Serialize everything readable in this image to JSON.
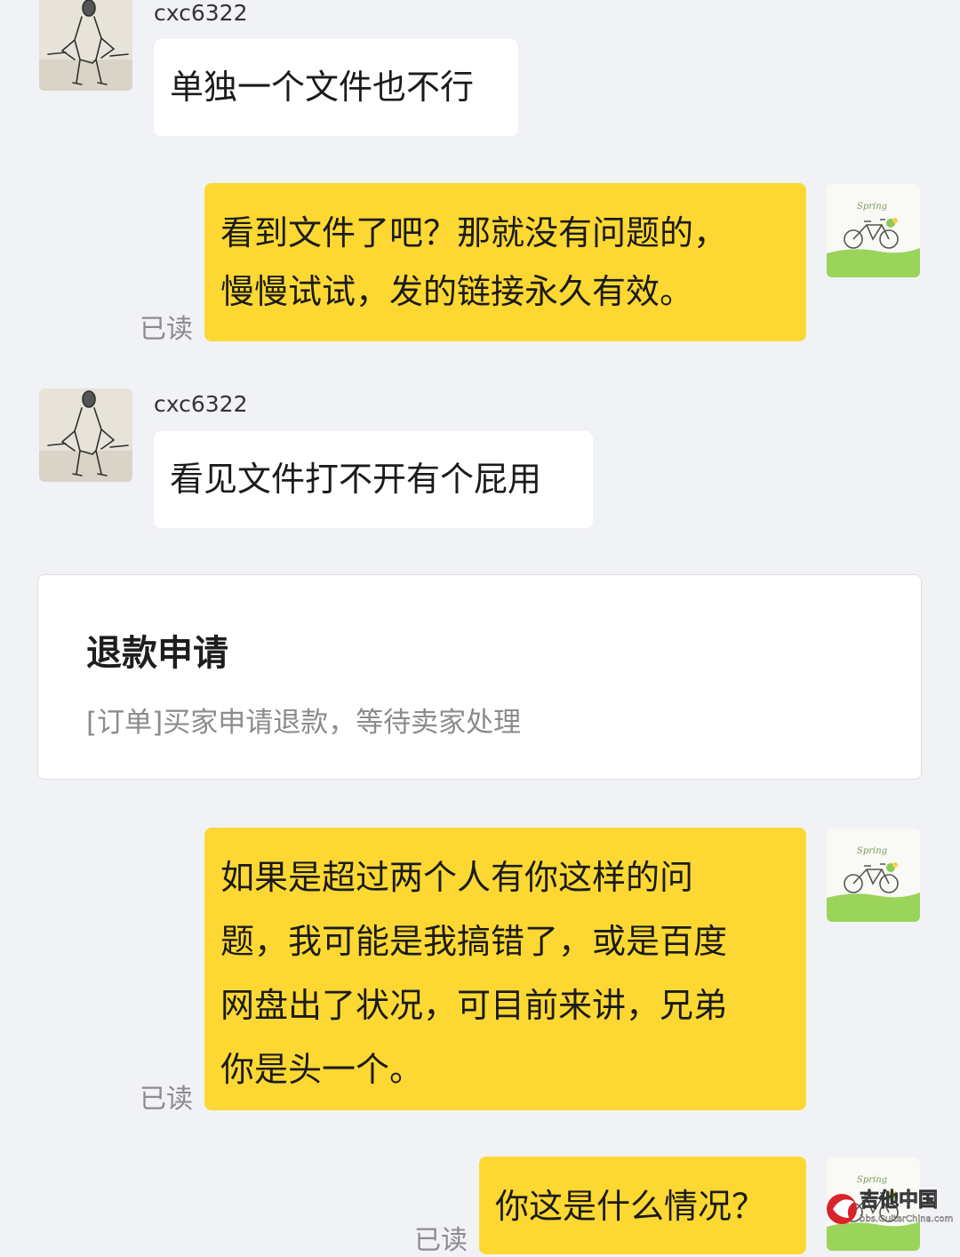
{
  "messages": [
    {
      "sender": "cxc6322",
      "text": "单独一个文件也不行"
    },
    {
      "lines": [
        "看到文件了吧？那就没有问题的，",
        "慢慢试试，发的链接永久有效。"
      ],
      "status": "已读"
    },
    {
      "sender": "cxc6322",
      "text": "看见文件打不开有个屁用"
    },
    {
      "lines": [
        "如果是超过两个人有你这样的问",
        "题，我可能是我搞错了，或是百度",
        "网盘出了状况，可目前来讲，兄弟",
        "你是头一个。"
      ],
      "status": "已读"
    },
    {
      "lines": [
        "你这是什么情况？"
      ],
      "status": "已读"
    }
  ],
  "refund_card": {
    "title": "退款申请",
    "description": "[订单]买家申请退款，等待卖家处理"
  },
  "colors": {
    "background": "#f1f2f6",
    "outgoing_bubble": "#fdd832",
    "incoming_bubble": "#ffffff"
  },
  "icons": {
    "user_avatar": "sketch-man-avatar",
    "self_avatar": "bicycle-avatar",
    "watermark": "guitarchina-logo"
  },
  "watermark": {
    "brand": "吉他中国",
    "site": "bbs.GuitarChina.com"
  }
}
